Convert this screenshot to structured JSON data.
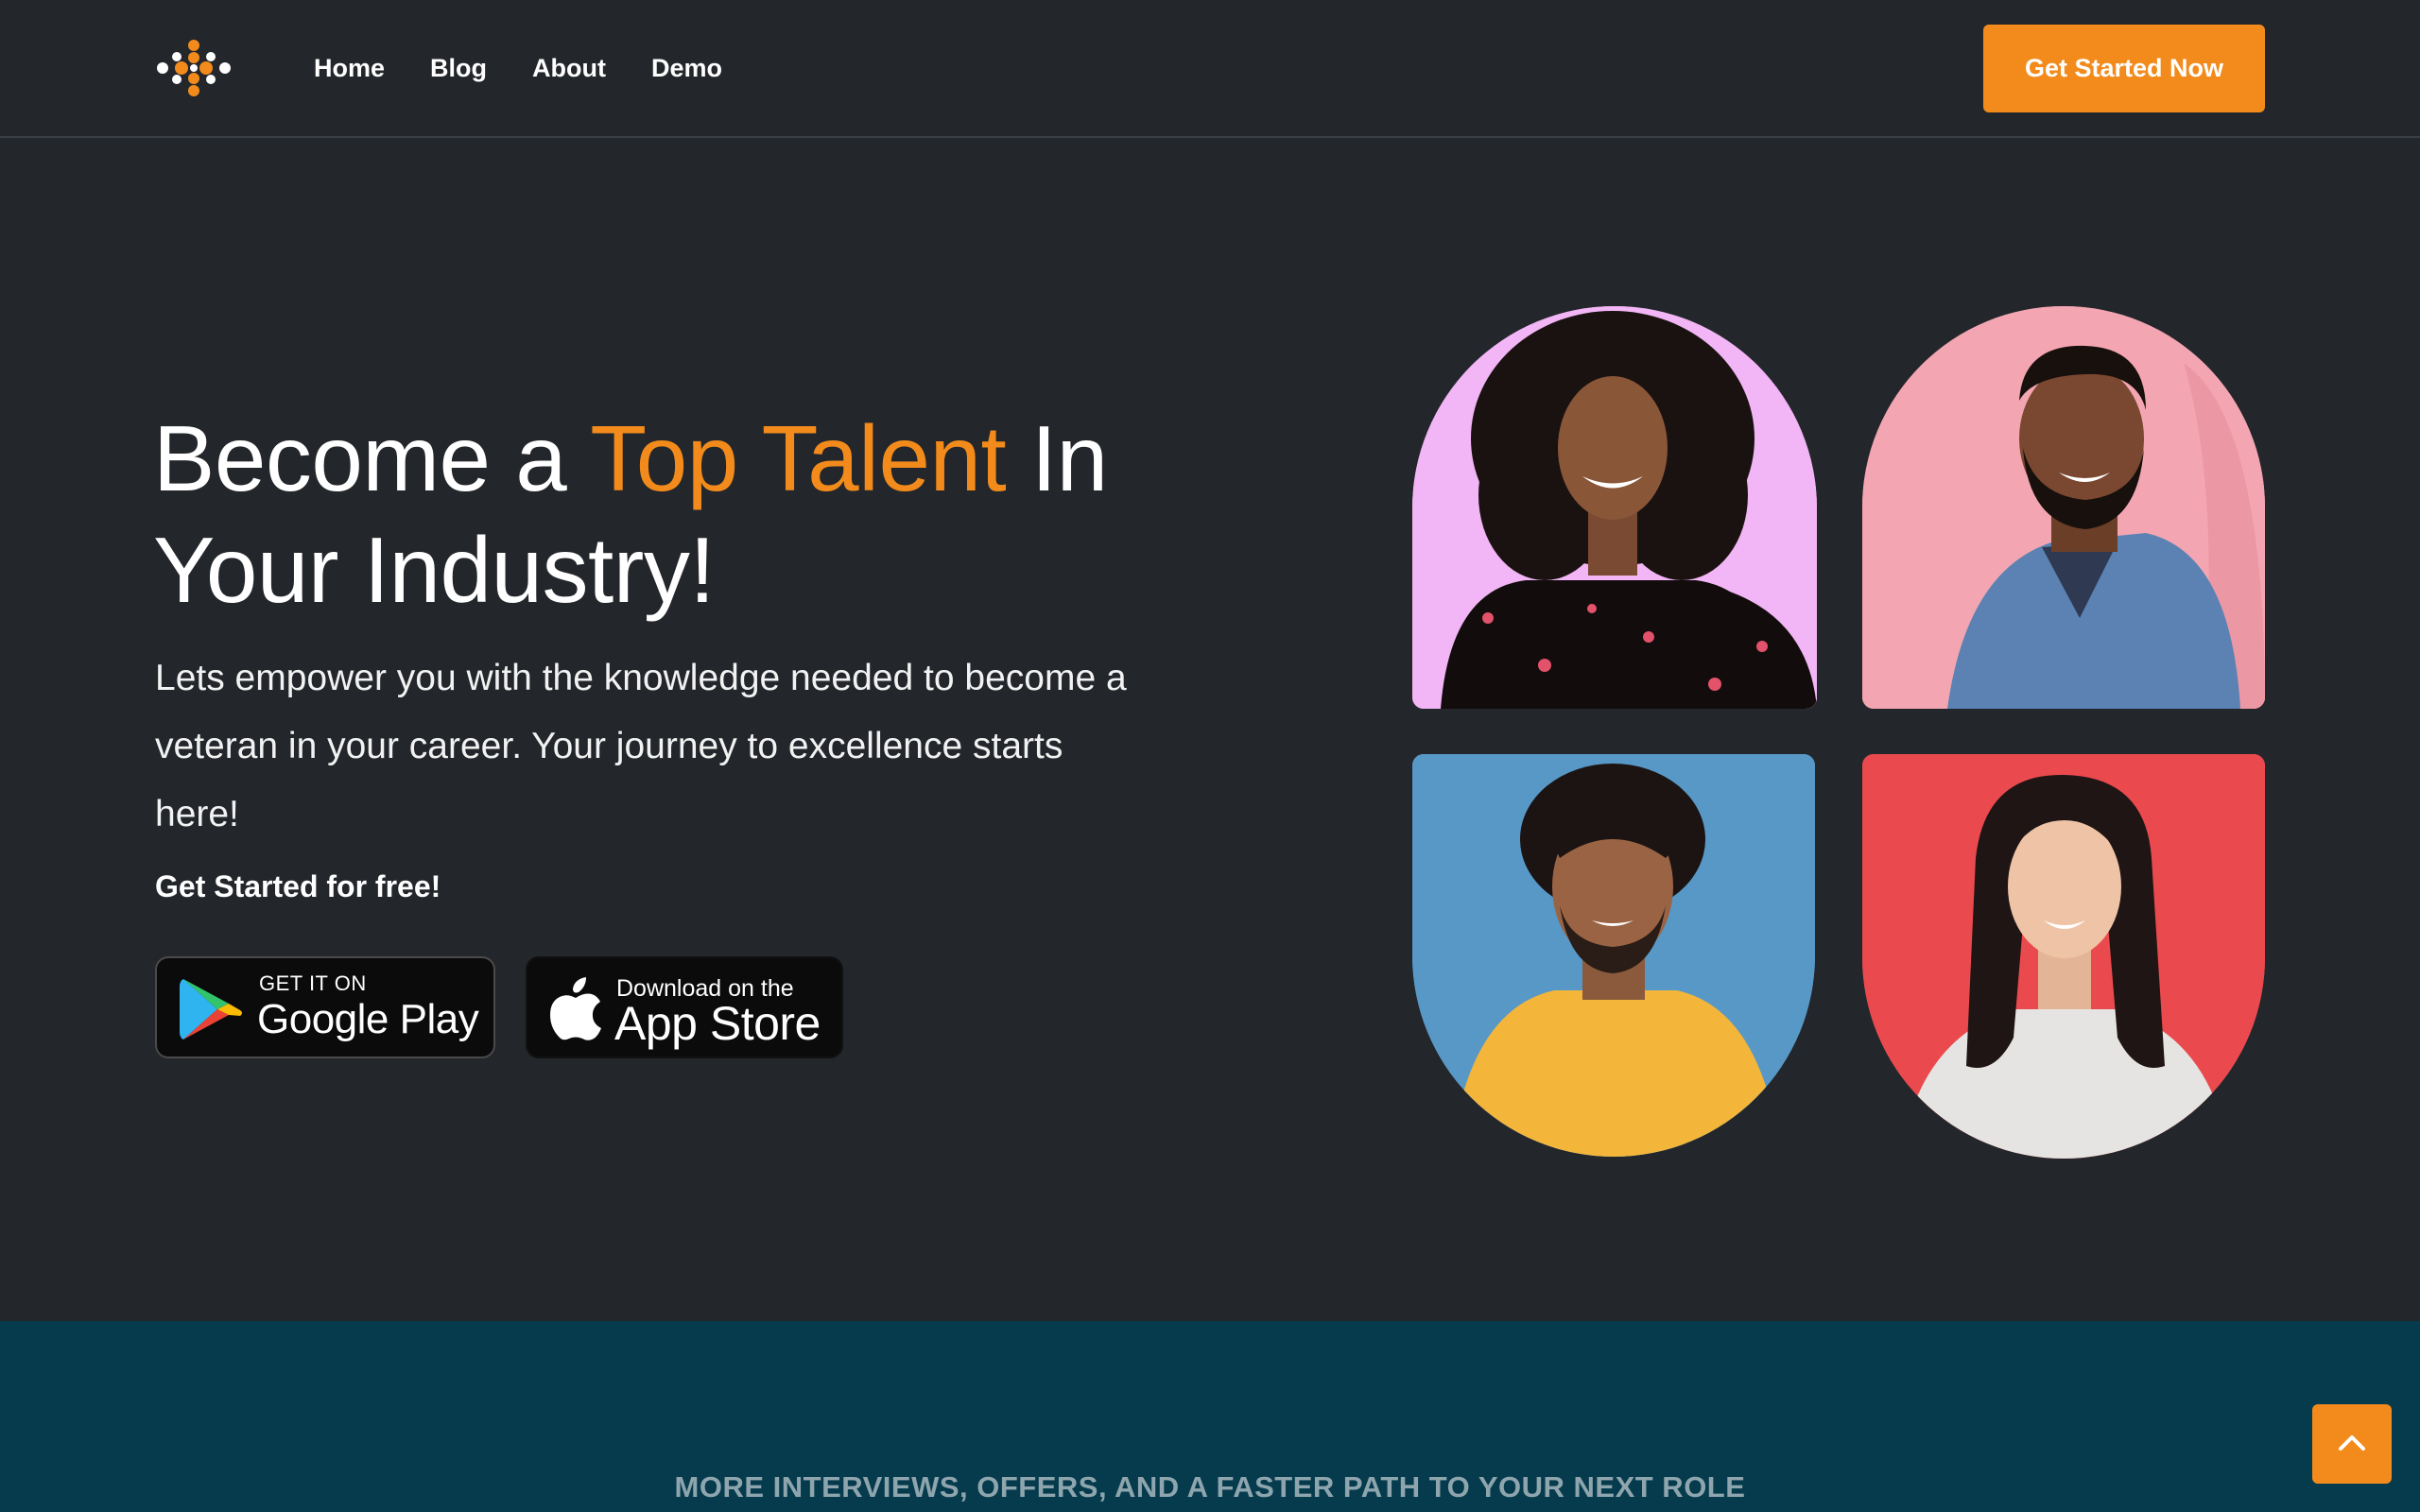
{
  "header": {
    "logo_icon": "dot-cluster-logo-icon",
    "nav": [
      "Home",
      "Blog",
      "About",
      "Demo"
    ],
    "cta_label": "Get Started Now"
  },
  "hero": {
    "title_prefix": "Become a ",
    "title_accent": "Top Talent",
    "title_suffix": " In Your Industry!",
    "subtitle": "Lets empower you with the knowledge needed to become a veteran in your career. Your journey to excellence starts here!",
    "free_label": "Get Started for free!"
  },
  "store_buttons": {
    "google_play": {
      "small": "GET IT ON",
      "big": "Google Play",
      "icon": "google-play-icon"
    },
    "app_store": {
      "small": "Download on the",
      "big": "App Store",
      "icon": "apple-icon"
    }
  },
  "portraits": [
    {
      "name": "portrait-woman-curly-hair",
      "background": "#f2b5f5"
    },
    {
      "name": "portrait-man-denim-jacket",
      "background": "#f3a6b2"
    },
    {
      "name": "portrait-man-yellow-shirt",
      "background": "#5898c7"
    },
    {
      "name": "portrait-woman-long-hair",
      "background": "#ea4a4e"
    }
  ],
  "band": {
    "tagline": "MORE INTERVIEWS, OFFERS, AND A FASTER PATH TO YOUR NEXT ROLE"
  },
  "colors": {
    "background": "#23262b",
    "accent": "#f28b1b",
    "band": "#053b4d"
  },
  "scroll_top_icon": "chevron-up-icon"
}
